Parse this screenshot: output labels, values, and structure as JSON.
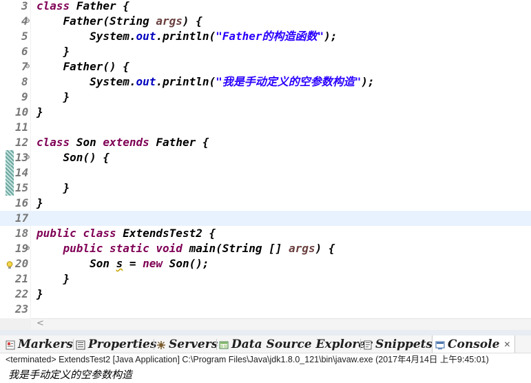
{
  "editor": {
    "current_line": "17",
    "lines": [
      {
        "n": "3",
        "fold": "",
        "tokens": [
          {
            "t": "kw",
            "v": "class"
          },
          {
            "t": "txt",
            "v": " Father {"
          }
        ]
      },
      {
        "n": "4",
        "fold": "⊖",
        "tokens": [
          {
            "t": "txt",
            "v": "    Father(String "
          },
          {
            "t": "par",
            "v": "args"
          },
          {
            "t": "txt",
            "v": ") {"
          }
        ]
      },
      {
        "n": "5",
        "fold": "",
        "tokens": [
          {
            "t": "txt",
            "v": "        System."
          },
          {
            "t": "fld",
            "v": "out"
          },
          {
            "t": "txt",
            "v": ".println("
          },
          {
            "t": "str",
            "v": "\"Father的构造函数\""
          },
          {
            "t": "txt",
            "v": ");"
          }
        ]
      },
      {
        "n": "6",
        "fold": "",
        "tokens": [
          {
            "t": "txt",
            "v": "    }"
          }
        ]
      },
      {
        "n": "7",
        "fold": "⊖",
        "tokens": [
          {
            "t": "txt",
            "v": "    Father() {"
          }
        ]
      },
      {
        "n": "8",
        "fold": "",
        "tokens": [
          {
            "t": "txt",
            "v": "        System."
          },
          {
            "t": "fld",
            "v": "out"
          },
          {
            "t": "txt",
            "v": ".println("
          },
          {
            "t": "str",
            "v": "\"我是手动定义的空参数构造\""
          },
          {
            "t": "txt",
            "v": ");"
          }
        ]
      },
      {
        "n": "9",
        "fold": "",
        "tokens": [
          {
            "t": "txt",
            "v": "    }"
          }
        ]
      },
      {
        "n": "10",
        "fold": "",
        "tokens": [
          {
            "t": "txt",
            "v": "}"
          }
        ]
      },
      {
        "n": "11",
        "fold": "",
        "tokens": []
      },
      {
        "n": "12",
        "fold": "",
        "tokens": [
          {
            "t": "kw",
            "v": "class"
          },
          {
            "t": "txt",
            "v": " Son "
          },
          {
            "t": "kw",
            "v": "extends"
          },
          {
            "t": "txt",
            "v": " Father {"
          }
        ]
      },
      {
        "n": "13",
        "fold": "⊖",
        "tokens": [
          {
            "t": "txt",
            "v": "    Son() {"
          }
        ]
      },
      {
        "n": "14",
        "fold": "",
        "tokens": []
      },
      {
        "n": "15",
        "fold": "",
        "tokens": [
          {
            "t": "txt",
            "v": "    }"
          }
        ]
      },
      {
        "n": "16",
        "fold": "",
        "tokens": [
          {
            "t": "txt",
            "v": "}"
          }
        ]
      },
      {
        "n": "17",
        "fold": "",
        "tokens": []
      },
      {
        "n": "18",
        "fold": "",
        "tokens": [
          {
            "t": "kw",
            "v": "public"
          },
          {
            "t": "txt",
            "v": " "
          },
          {
            "t": "kw",
            "v": "class"
          },
          {
            "t": "txt",
            "v": " ExtendsTest2 {"
          }
        ]
      },
      {
        "n": "19",
        "fold": "⊖",
        "tokens": [
          {
            "t": "txt",
            "v": "    "
          },
          {
            "t": "kw",
            "v": "public"
          },
          {
            "t": "txt",
            "v": " "
          },
          {
            "t": "kw",
            "v": "static"
          },
          {
            "t": "txt",
            "v": " "
          },
          {
            "t": "kw",
            "v": "void"
          },
          {
            "t": "txt",
            "v": " main(String [] "
          },
          {
            "t": "par",
            "v": "args"
          },
          {
            "t": "txt",
            "v": ") {"
          }
        ]
      },
      {
        "n": "20",
        "fold": "",
        "tokens": [
          {
            "t": "txt",
            "v": "        Son "
          },
          {
            "t": "warn",
            "v": "s"
          },
          {
            "t": "txt",
            "v": " = "
          },
          {
            "t": "kw",
            "v": "new"
          },
          {
            "t": "txt",
            "v": " Son();"
          }
        ]
      },
      {
        "n": "21",
        "fold": "",
        "tokens": [
          {
            "t": "txt",
            "v": "    }"
          }
        ]
      },
      {
        "n": "22",
        "fold": "",
        "tokens": [
          {
            "t": "txt",
            "v": "}"
          }
        ]
      },
      {
        "n": "23",
        "fold": "",
        "tokens": []
      }
    ],
    "change_marker_lines": [
      "13",
      "14",
      "15"
    ],
    "warning_line": "20"
  },
  "scrollbar": {
    "left_arrow": "<"
  },
  "tabs": [
    {
      "label": "Markers",
      "icon": "markers-icon"
    },
    {
      "label": "Properties",
      "icon": "properties-icon"
    },
    {
      "label": "Servers",
      "icon": "servers-icon"
    },
    {
      "label": "Data Source Explorer",
      "icon": "data-source-explorer-icon"
    },
    {
      "label": "Snippets",
      "icon": "snippets-icon"
    },
    {
      "label": "Console",
      "icon": "console-icon",
      "active": true,
      "close": "✕"
    }
  ],
  "console": {
    "header": "<terminated> ExtendsTest2 [Java Application] C:\\Program Files\\Java\\jdk1.8.0_121\\bin\\javaw.exe (2017年4月14日 上午9:45:01)",
    "output": "我是手动定义的空参数构造"
  },
  "colors": {
    "keyword": "#7f0055",
    "string": "#2a00ff",
    "field": "#0000c0",
    "parameter": "#6a3e3e",
    "current_line_bg": "#e8f2fe"
  }
}
